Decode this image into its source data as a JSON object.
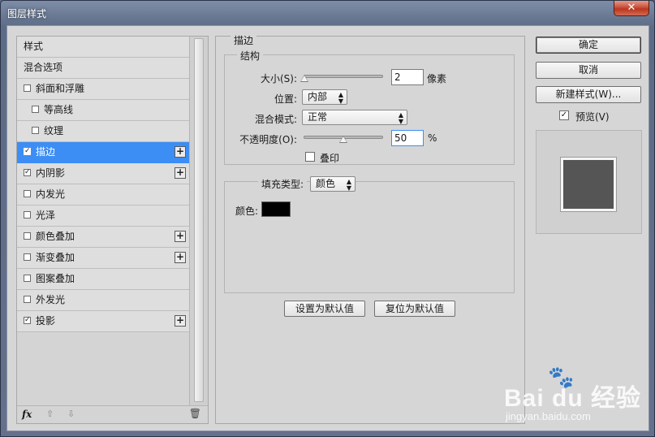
{
  "window": {
    "title": "图层样式",
    "close_label": "✕"
  },
  "sidebar": {
    "items": [
      {
        "label": "样式",
        "checked": null,
        "plus": false,
        "indent": false,
        "selected": false
      },
      {
        "label": "混合选项",
        "checked": null,
        "plus": false,
        "indent": false,
        "selected": false
      },
      {
        "label": "斜面和浮雕",
        "checked": false,
        "plus": false,
        "indent": false,
        "selected": false
      },
      {
        "label": "等高线",
        "checked": false,
        "plus": false,
        "indent": true,
        "selected": false
      },
      {
        "label": "纹理",
        "checked": false,
        "plus": false,
        "indent": true,
        "selected": false
      },
      {
        "label": "描边",
        "checked": true,
        "plus": true,
        "indent": false,
        "selected": true
      },
      {
        "label": "内阴影",
        "checked": true,
        "plus": true,
        "indent": false,
        "selected": false
      },
      {
        "label": "内发光",
        "checked": false,
        "plus": false,
        "indent": false,
        "selected": false
      },
      {
        "label": "光泽",
        "checked": false,
        "plus": false,
        "indent": false,
        "selected": false
      },
      {
        "label": "颜色叠加",
        "checked": false,
        "plus": true,
        "indent": false,
        "selected": false
      },
      {
        "label": "渐变叠加",
        "checked": false,
        "plus": true,
        "indent": false,
        "selected": false
      },
      {
        "label": "图案叠加",
        "checked": false,
        "plus": false,
        "indent": false,
        "selected": false
      },
      {
        "label": "外发光",
        "checked": false,
        "plus": false,
        "indent": false,
        "selected": false
      },
      {
        "label": "投影",
        "checked": true,
        "plus": true,
        "indent": false,
        "selected": false
      }
    ],
    "footer": {
      "fx": "fx",
      "up": "⇧",
      "down": "⇩",
      "trash": "🗑"
    }
  },
  "stroke": {
    "section_title": "描边",
    "structure_title": "结构",
    "size_label": "大小(S):",
    "size_value": "2",
    "size_unit": "像素",
    "size_slider": 0.01,
    "position_label": "位置:",
    "position_value": "内部",
    "blend_label": "混合模式:",
    "blend_value": "正常",
    "opacity_label": "不透明度(O):",
    "opacity_value": "50",
    "opacity_unit": "%",
    "opacity_slider": 0.5,
    "overprint_label": "叠印",
    "overprint_checked": false,
    "fill_type_label": "填充类型:",
    "fill_type_value": "颜色",
    "color_label": "颜色:",
    "color_value": "#000000",
    "set_default": "设置为默认值",
    "reset_default": "复位为默认值"
  },
  "actions": {
    "ok": "确定",
    "cancel": "取消",
    "new_style": "新建样式(W)...",
    "preview_label": "预览(V)",
    "preview_checked": true
  },
  "watermark": {
    "brand": "Bai du 经验",
    "url": "jingyan.baidu.com"
  },
  "colors": {
    "selection": "#3c8ef5",
    "preview_fill": "#555555"
  }
}
